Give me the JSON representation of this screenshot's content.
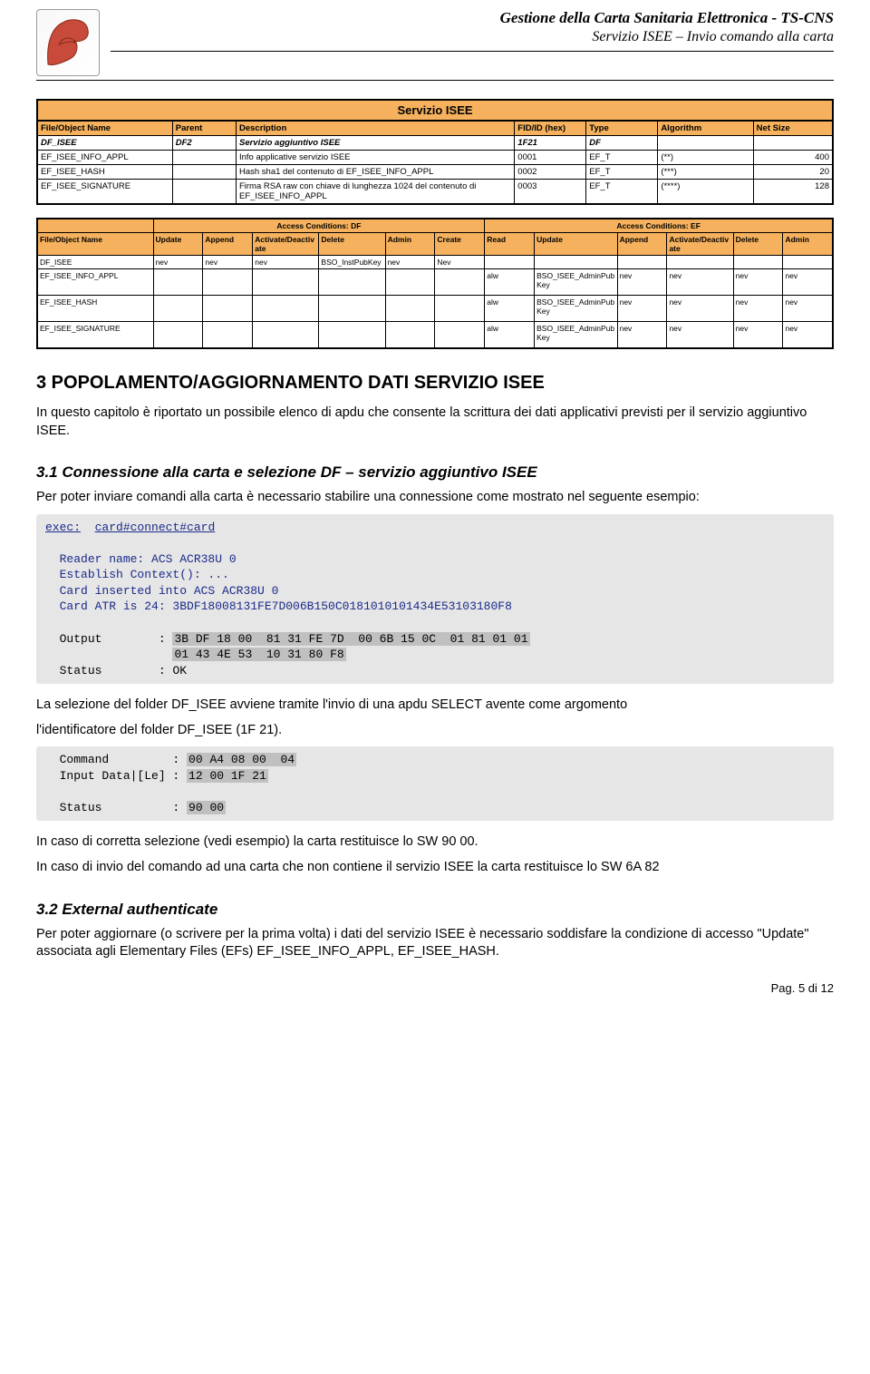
{
  "header": {
    "title": "Gestione della Carta Sanitaria Elettronica - TS-CNS",
    "subtitle": "Servizio ISEE – Invio comando alla carta"
  },
  "table1": {
    "caption": "Servizio ISEE",
    "headers": [
      "File/Object Name",
      "Parent",
      "Description",
      "FID/ID (hex)",
      "Type",
      "Algorithm",
      "Net Size"
    ],
    "rows": [
      {
        "name": "DF_ISEE",
        "parent": "DF2",
        "desc": "Servizio aggiuntivo ISEE",
        "fid": "1F21",
        "type": "DF",
        "alg": "",
        "size": "",
        "em": true
      },
      {
        "name": "EF_ISEE_INFO_APPL",
        "parent": "",
        "desc": "Info applicative servizio ISEE",
        "fid": "0001",
        "type": "EF_T",
        "alg": "(**)",
        "size": "400"
      },
      {
        "name": "EF_ISEE_HASH",
        "parent": "",
        "desc": "Hash sha1 del contenuto di EF_ISEE_INFO_APPL",
        "fid": "0002",
        "type": "EF_T",
        "alg": "(***)",
        "size": "20"
      },
      {
        "name": "EF_ISEE_SIGNATURE",
        "parent": "",
        "desc": "Firma RSA raw con chiave di lunghezza 1024 del contenuto di EF_ISEE_INFO_APPL",
        "fid": "0003",
        "type": "EF_T",
        "alg": "(****)",
        "size": "128"
      }
    ]
  },
  "table2": {
    "secDF": "Access Conditions: DF",
    "secEF": "Access Conditions: EF",
    "cols": [
      "File/Object Name",
      "Update",
      "Append",
      "Activate/Deactivate",
      "Delete",
      "Admin",
      "Create",
      "Read",
      "Update",
      "Append",
      "Activate/Deactivate",
      "Delete",
      "Admin"
    ],
    "df_row": {
      "name": "DF_ISEE",
      "update": "nev",
      "append": "nev",
      "adact": "nev",
      "delete": "BSO_InstPubKey",
      "admin": "nev",
      "create": "Nev"
    },
    "ef_rows": [
      {
        "name": "EF_ISEE_INFO_APPL",
        "read": "alw",
        "update": "BSO_ISEE_AdminPubKey",
        "append": "nev",
        "adact": "nev",
        "delete": "nev",
        "admin": "nev"
      },
      {
        "name": "EF_ISEE_HASH",
        "read": "alw",
        "update": "BSO_ISEE_AdminPubKey",
        "append": "nev",
        "adact": "nev",
        "delete": "nev",
        "admin": "nev"
      },
      {
        "name": "EF_ISEE_SIGNATURE",
        "read": "alw",
        "update": "BSO_ISEE_AdminPubKey",
        "append": "nev",
        "adact": "nev",
        "delete": "nev",
        "admin": "nev"
      }
    ]
  },
  "sec3": {
    "heading": "3 POPOLAMENTO/AGGIORNAMENTO DATI SERVIZIO ISEE",
    "para1": "In questo capitolo è riportato un possibile elenco di apdu che consente la scrittura dei dati applicativi previsti per il servizio aggiuntivo ISEE."
  },
  "sec31": {
    "heading": "3.1 Connessione alla carta e selezione DF – servizio aggiuntivo ISEE",
    "para": "Per poter inviare comandi alla carta è necessario stabilire una connessione come mostrato nel seguente esempio:",
    "code_exec_label": "exec:",
    "code_exec_cmd": "card#connect#card",
    "code_reader": "Reader name: ACS ACR38U 0",
    "code_establish": "Establish Context(): ...",
    "code_inserted": "Card inserted into ACS ACR38U 0",
    "code_atr": "Card ATR is 24: 3BDF18008131FE7D006B150C0181010101434E53103180F8",
    "code_output_label": "Output",
    "code_output_val1": "3B DF 18 00  81 31 FE 7D  00 6B 15 0C  01 81 01 01",
    "code_output_val2": "01 43 4E 53  10 31 80 F8",
    "code_status_label": "Status",
    "code_status_val": "OK",
    "para_after1": "La selezione del folder DF_ISEE avviene tramite l'invio di una apdu SELECT avente come argomento",
    "para_after2": "l'identificatore del folder DF_ISEE (1F 21).",
    "code2_cmd_label": "Command",
    "code2_cmd_val": "00 A4 08 00  04",
    "code2_input_label": "Input Data|[Le] :",
    "code2_input_val": "12 00 1F 21",
    "code2_status_label": "Status",
    "code2_status_val": "90 00",
    "para_end1": "In caso di corretta selezione (vedi esempio) la carta restituisce lo SW 90 00.",
    "para_end2": "In caso di invio del comando ad una carta che non contiene il servizio ISEE la carta restituisce lo SW 6A 82"
  },
  "sec32": {
    "heading": "3.2 External authenticate",
    "para": "Per poter aggiornare (o scrivere per la prima volta) i dati del servizio ISEE è necessario soddisfare la condizione di accesso \"Update\" associata agli Elementary Files (EFs) EF_ISEE_INFO_APPL, EF_ISEE_HASH."
  },
  "footer": {
    "text": "Pag. 5 di 12"
  }
}
